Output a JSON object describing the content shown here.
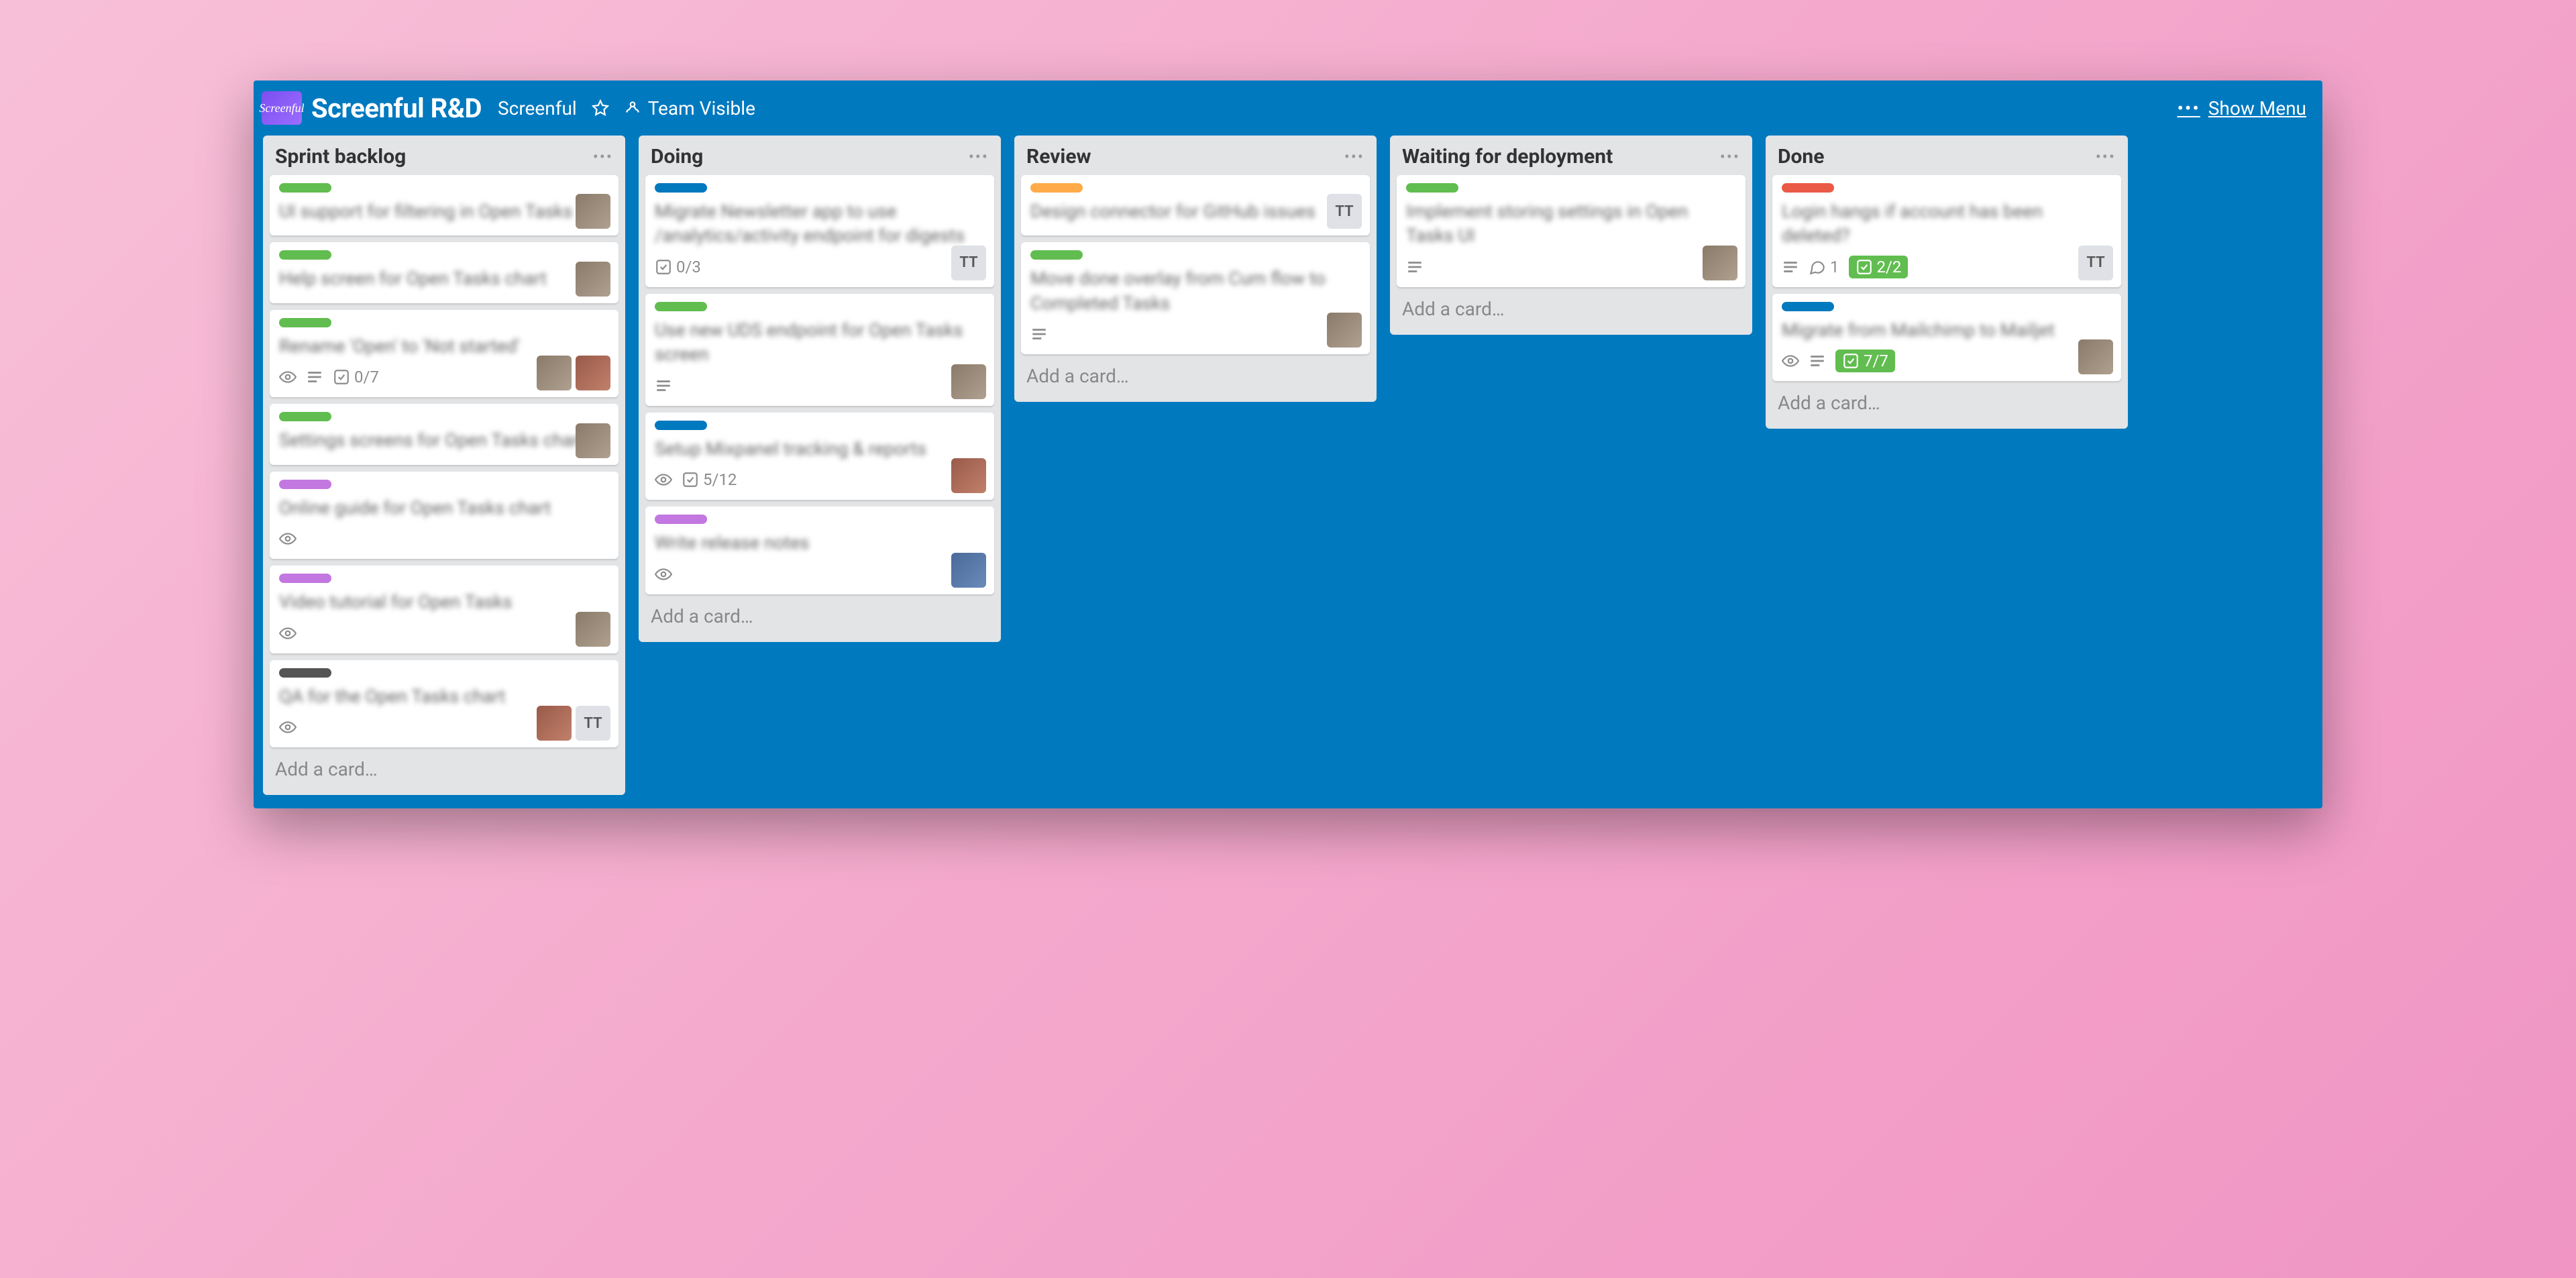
{
  "header": {
    "brand_text": "Screenful",
    "board_title": "Screenful R&D",
    "org_label": "Screenful",
    "visibility_label": "Team Visible",
    "show_menu_label": "Show Menu"
  },
  "add_card_label": "Add a card…",
  "lists": [
    {
      "title": "Sprint backlog",
      "cards": [
        {
          "label": "green",
          "title": "UI support for filtering in Open Tasks",
          "badges": {},
          "members": [
            "a"
          ]
        },
        {
          "label": "green",
          "title": "Help screen for Open Tasks chart",
          "badges": {},
          "members": [
            "a"
          ]
        },
        {
          "label": "green",
          "title": "Rename 'Open' to 'Not started'",
          "badges": {
            "watch": true,
            "desc": true,
            "checklist": "0/7"
          },
          "members": [
            "a",
            "b"
          ]
        },
        {
          "label": "green",
          "title": "Settings screens for Open Tasks chart",
          "badges": {},
          "members": [
            "a"
          ]
        },
        {
          "label": "purple",
          "title": "Online guide for Open Tasks chart",
          "badges": {
            "watch": true
          },
          "members": []
        },
        {
          "label": "purple",
          "title": "Video tutorial for Open Tasks",
          "badges": {
            "watch": true
          },
          "members": [
            "a"
          ]
        },
        {
          "label": "dark",
          "title": "QA for the Open Tasks chart",
          "badges": {
            "watch": true
          },
          "members": [
            "b",
            "TT"
          ]
        }
      ]
    },
    {
      "title": "Doing",
      "cards": [
        {
          "label": "blue",
          "title": "Migrate Newsletter app to use /analytics/activity endpoint for digests",
          "badges": {
            "checklist": "0/3"
          },
          "members": [
            "TT"
          ]
        },
        {
          "label": "green",
          "title": "Use new UDS endpoint for Open Tasks screen",
          "badges": {
            "desc": true
          },
          "members": [
            "a"
          ]
        },
        {
          "label": "blue",
          "title": "Setup Mixpanel tracking & reports",
          "badges": {
            "watch": true,
            "checklist": "5/12"
          },
          "members": [
            "b"
          ]
        },
        {
          "label": "purple",
          "title": "Write release notes",
          "badges": {
            "watch": true
          },
          "members": [
            "c"
          ]
        }
      ]
    },
    {
      "title": "Review",
      "cards": [
        {
          "label": "orange",
          "title": "Design connector for GitHub issues",
          "badges": {},
          "members": [
            "TT"
          ]
        },
        {
          "label": "green",
          "title": "Move done overlay from Cum flow to Completed Tasks",
          "badges": {
            "desc": true
          },
          "members": [
            "a"
          ]
        }
      ]
    },
    {
      "title": "Waiting for deployment",
      "cards": [
        {
          "label": "green",
          "title": "Implement storing settings in Open Tasks UI",
          "badges": {
            "desc": true
          },
          "members": [
            "a"
          ]
        }
      ]
    },
    {
      "title": "Done",
      "cards": [
        {
          "label": "red",
          "title": "Login hangs if account has been deleted?",
          "badges": {
            "desc": true,
            "comments": "1",
            "checklist": "2/2",
            "checklist_done": true
          },
          "members": [
            "TT"
          ]
        },
        {
          "label": "blue",
          "title": "Migrate from Mailchimp to Mailjet",
          "badges": {
            "watch": true,
            "desc": true,
            "checklist": "7/7",
            "checklist_done": true
          },
          "members": [
            "a"
          ]
        }
      ]
    }
  ]
}
